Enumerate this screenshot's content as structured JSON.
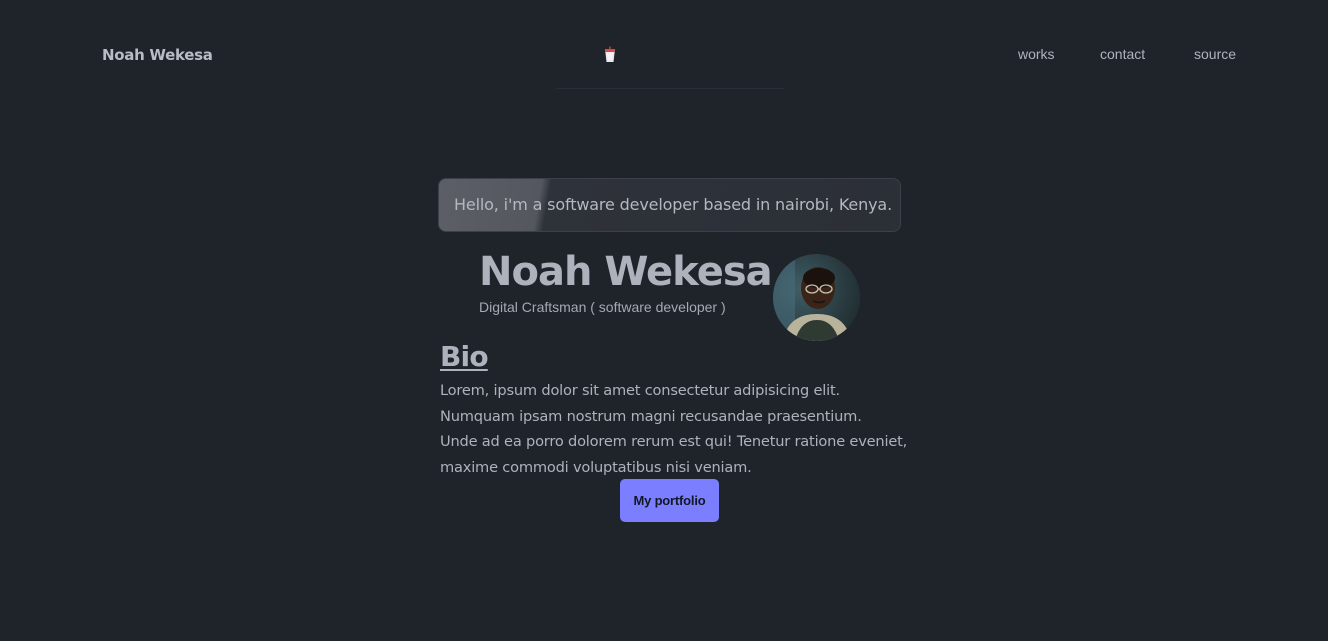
{
  "header": {
    "brand": "Noah Wekesa",
    "logo_icon": "cup-icon",
    "nav": {
      "works": "works",
      "contact": "contact",
      "source": "source"
    }
  },
  "hero": {
    "greeting": "Hello, i'm a software developer based in nairobi, Kenya.",
    "name": "Noah Wekesa",
    "subtitle": "Digital Craftsman ( software developer )",
    "avatar_icon": "profile-photo"
  },
  "bio": {
    "heading": "Bio",
    "lines": [
      "Lorem, ipsum dolor sit amet consectetur adipisicing elit.",
      "Numquam ipsam nostrum magni recusandae praesentium.",
      "Unde ad ea porro dolorem rerum est qui! Tenetur ratione eveniet,",
      "maxime commodi voluptatibus nisi veniam."
    ]
  },
  "actions": {
    "portfolio_label": "My portfolio"
  },
  "colors": {
    "background": "#1f232a",
    "accent": "#7b7fff",
    "text": "#aeb2bc"
  }
}
